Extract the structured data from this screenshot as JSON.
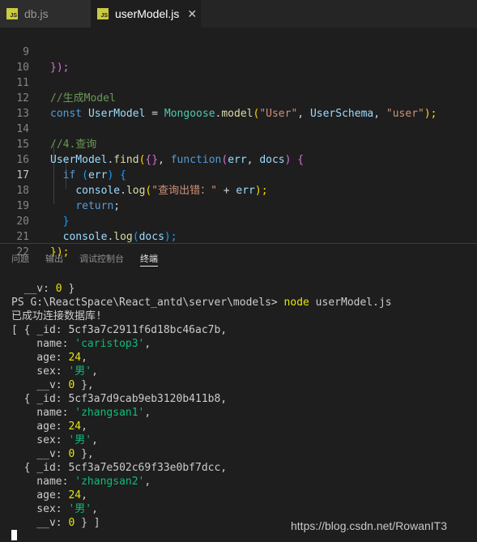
{
  "tabs": [
    {
      "label": "db.js",
      "icon": "js-file-icon",
      "active": false
    },
    {
      "label": "userModel.js",
      "icon": "js-file-icon",
      "active": true
    }
  ],
  "tab_close": "✕",
  "js_icon_text": "JS",
  "editor": {
    "current_line": 17,
    "lines": [
      {
        "n": "9"
      },
      {
        "n": "10"
      },
      {
        "n": "11"
      },
      {
        "n": "12"
      },
      {
        "n": "13"
      },
      {
        "n": "14"
      },
      {
        "n": "15"
      },
      {
        "n": "16"
      },
      {
        "n": "17"
      },
      {
        "n": "18"
      },
      {
        "n": "19"
      },
      {
        "n": "20"
      },
      {
        "n": "21"
      },
      {
        "n": "22"
      }
    ],
    "code": {
      "l9_close": "});",
      "l11_comment": "//生成Model",
      "l12_const": "const",
      "l12_name": "UserModel",
      "l12_eq": " = ",
      "l12_obj": "Mongoose",
      "l12_dot": ".",
      "l12_fn": "model",
      "l12_open": "(",
      "l12_str1": "\"User\"",
      "l12_comma1": ", ",
      "l12_schema": "UserSchema",
      "l12_comma2": ", ",
      "l12_str2": "\"user\"",
      "l12_close": ");",
      "l14_comment": "//4.查询",
      "l15_obj": "UserModel",
      "l15_dot": ".",
      "l15_fn": "find",
      "l15_open": "(",
      "l15_obj_lit": "{}",
      "l15_comma": ", ",
      "l15_function": "function",
      "l15_params_open": "(",
      "l15_err": "err",
      "l15_pcomma": ", ",
      "l15_docs": "docs",
      "l15_params_close": ")",
      "l15_brace": " {",
      "l16_if": "if",
      "l16_open": " (",
      "l16_err": "err",
      "l16_close": ")",
      "l16_brace": " {",
      "l17_console": "console",
      "l17_dot": ".",
      "l17_log": "log",
      "l17_open": "(",
      "l17_str": "\"查询出错：\"",
      "l17_plus": " + ",
      "l17_err": "err",
      "l17_close": ");",
      "l18_return": "return",
      "l18_semi": ";",
      "l19_close": "}",
      "l20_console": "console",
      "l20_dot": ".",
      "l20_log": "log",
      "l20_open": "(",
      "l20_docs": "docs",
      "l20_close": ");",
      "l21_close": "});"
    }
  },
  "panel": {
    "tabs": [
      {
        "label": "问题",
        "active": false
      },
      {
        "label": "输出",
        "active": false
      },
      {
        "label": "调试控制台",
        "active": false
      },
      {
        "label": "终端",
        "active": true
      }
    ]
  },
  "terminal": {
    "v_key": "__v: ",
    "zero": "0",
    "prompt": "PS G:\\ReactSpace\\React_antd\\server\\models> ",
    "cmd_node": "node",
    "cmd_arg": " userModel.js",
    "connected_msg": "已成功连接数据库!",
    "docs": [
      {
        "id": "5cf3a7c2911f6d18bc46ac7b",
        "name": "'caristop3'",
        "age": "24",
        "sex": "'男'",
        "v": "0"
      },
      {
        "id": "5cf3a7d9cab9eb3120b411b8",
        "name": "'zhangsan1'",
        "age": "24",
        "sex": "'男'",
        "v": "0"
      },
      {
        "id": "5cf3a7e502c69f33e0bf7dcc",
        "name": "'zhangsan2'",
        "age": "24",
        "sex": "'男'",
        "v": "0"
      }
    ]
  },
  "watermark": "https://blog.csdn.net/RowanIT3"
}
